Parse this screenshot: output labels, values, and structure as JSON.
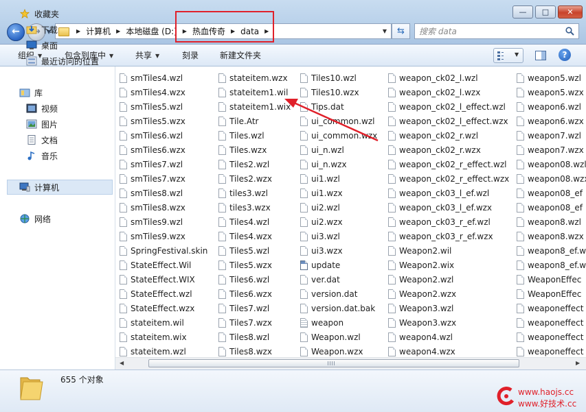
{
  "window": {
    "minimize_glyph": "—",
    "maximize_glyph": "□",
    "close_glyph": "✕"
  },
  "address": {
    "crumbs": [
      "计算机",
      "本地磁盘 (D:)",
      "热血传奇",
      "data"
    ]
  },
  "search": {
    "placeholder": "搜索 data"
  },
  "toolbar": {
    "organize": "组织",
    "include_in_library": "包含到库中",
    "share": "共享",
    "burn": "刻录",
    "new_folder": "新建文件夹",
    "help": "?"
  },
  "nav": {
    "favorites": "收藏夹",
    "downloads": "下载",
    "desktop": "桌面",
    "recent": "最近访问的位置",
    "libraries": "库",
    "videos": "视频",
    "pictures": "图片",
    "documents": "文档",
    "music": "音乐",
    "computer": "计算机",
    "network": "网络"
  },
  "files": {
    "col1": [
      "smTiles4.wzl",
      "smTiles4.wzx",
      "smTiles5.wzl",
      "smTiles5.wzx",
      "smTiles6.wzl",
      "smTiles6.wzx",
      "smTiles7.wzl",
      "smTiles7.wzx",
      "smTiles8.wzl",
      "smTiles8.wzx",
      "smTiles9.wzl",
      "smTiles9.wzx",
      "SpringFestival.skin",
      "StateEffect.Wil",
      "StateEffect.WIX",
      "StateEffect.wzl",
      "StateEffect.wzx",
      "stateitem.wil",
      "stateitem.wix",
      "stateitem.wzl"
    ],
    "col2": [
      "stateitem.wzx",
      "stateitem1.wil",
      "stateitem1.wix",
      "Tile.Atr",
      "Tiles.wzl",
      "Tiles.wzx",
      "Tiles2.wzl",
      "Tiles2.wzx",
      "tiles3.wzl",
      "tiles3.wzx",
      "Tiles4.wzl",
      "Tiles4.wzx",
      "Tiles5.wzl",
      "Tiles5.wzx",
      "Tiles6.wzl",
      "Tiles6.wzx",
      "Tiles7.wzl",
      "Tiles7.wzx",
      "Tiles8.wzl",
      "Tiles8.wzx"
    ],
    "col3": [
      "Tiles10.wzl",
      "Tiles10.wzx",
      "Tips.dat",
      "ui_common.wzl",
      "ui_common.wzx",
      "ui_n.wzl",
      "ui_n.wzx",
      "ui1.wzl",
      "ui1.wzx",
      "ui2.wzl",
      "ui2.wzx",
      "ui3.wzl",
      "ui3.wzx",
      "update",
      "ver.dat",
      "version.dat",
      "version.dat.bak",
      "weapon",
      "Weapon.wzl",
      "Weapon.wzx"
    ],
    "col4": [
      "weapon_ck02_l.wzl",
      "weapon_ck02_l.wzx",
      "weapon_ck02_l_effect.wzl",
      "weapon_ck02_l_effect.wzx",
      "weapon_ck02_r.wzl",
      "weapon_ck02_r.wzx",
      "weapon_ck02_r_effect.wzl",
      "weapon_ck02_r_effect.wzx",
      "weapon_ck03_l_ef.wzl",
      "weapon_ck03_l_ef.wzx",
      "weapon_ck03_r_ef.wzl",
      "weapon_ck03_r_ef.wzx",
      "Weapon2.wil",
      "Weapon2.wix",
      "Weapon2.wzl",
      "Weapon2.wzx",
      "Weapon3.wzl",
      "Weapon3.wzx",
      "weapon4.wzl",
      "weapon4.wzx"
    ],
    "col5": [
      "weapon5.wzl",
      "weapon5.wzx",
      "weapon6.wzl",
      "weapon6.wzx",
      "weapon7.wzl",
      "weapon7.wzx",
      "weapon08.wzl",
      "weapon08.wzx",
      "weapon08_ef",
      "weapon08_ef",
      "weapon8.wzl",
      "weapon8.wzx",
      "weapon8_ef.w",
      "weapon8_ef.w",
      "WeaponEffec",
      "WeaponEffec",
      "weaponeffect",
      "weaponeffect",
      "weaponeffect",
      "weaponeffect"
    ]
  },
  "status": {
    "count": "655 个对象"
  },
  "watermark": {
    "line1": "www.haojs.cc",
    "line2": "www.好技术.cc"
  },
  "colors": {
    "annotation_red": "#e0202a",
    "selection": "#dbe8f6"
  }
}
